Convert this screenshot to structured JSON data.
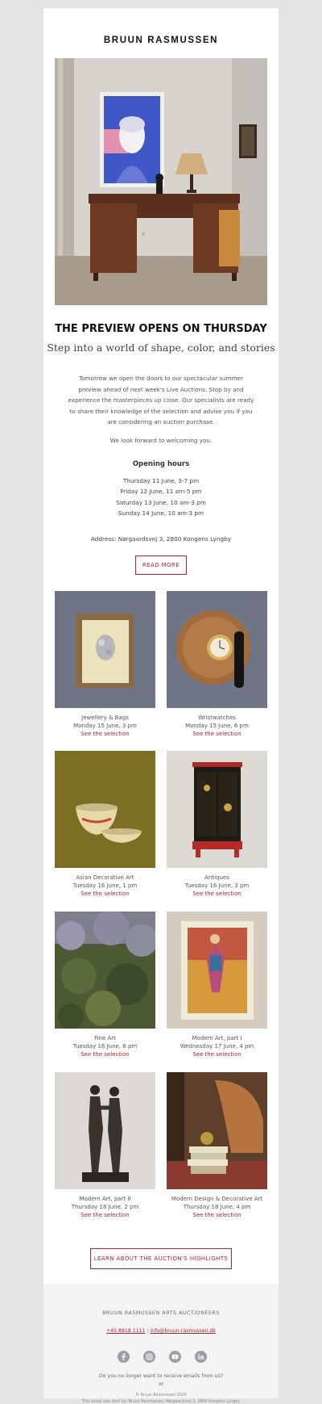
{
  "brand": "BRUUN RASMUSSEN",
  "hero": {
    "title": "THE PREVIEW OPENS ON THURSDAY",
    "subtitle": "Step into a world of shape, color, and stories"
  },
  "intro": {
    "line1": "Tomorrow we open the doors to our spectacular summer",
    "line2": "preview ahead of next week's Live Auctions. Stop by and",
    "line3": "experience the masterpieces up close. Our specialists are ready",
    "line4": "to share their knowledge of the selection and advise you if you",
    "line5": "are considering an auction purchase.",
    "welcome": "We look forward to welcoming you."
  },
  "opening_hours": {
    "heading": "Opening hours",
    "items": [
      "Thursday 11 June, 3-7 pm",
      "Friday 12 June, 11 am-5 pm",
      "Saturday 13 June, 10 am-3 pm",
      "Sunday 14 June, 10 am-3 pm"
    ]
  },
  "address": "Address: Nørgaardsvej 3, 2800 Kongens Lyngby",
  "buttons": {
    "read_more": "READ MORE",
    "learn": "LEARN ABOUT THE AUCTION'S HIGHLIGHTS"
  },
  "auctions": [
    {
      "category": "Jewellery & Bags",
      "date": "Monday 15 June, 3 pm",
      "link": "See the selection"
    },
    {
      "category": "Wristwatches",
      "date": "Monday 15 June, 6 pm",
      "link": "See the selection"
    },
    {
      "category": "Asian Decorative Art",
      "date": "Tuesday 16 June, 1 pm",
      "link": "See the selection"
    },
    {
      "category": "Antiques",
      "date": "Tuesday 16 June, 3 pm",
      "link": "See the selection"
    },
    {
      "category": "Fine Art",
      "date": "Tuesday 16 June, 6 pm",
      "link": "See the selection"
    },
    {
      "category": "Modern Art, part I",
      "date": "Wednesday 17 June, 4 pm",
      "link": "See the selection"
    },
    {
      "category": "Modern Art, part II",
      "date": "Thursday 18 June, 2 pm",
      "link": "See the selection"
    },
    {
      "category": "Modern Design & Decorative Art",
      "date": "Thursday 18 June, 4 pm",
      "link": "See the selection"
    }
  ],
  "footer": {
    "company": "BRUUN RASMUSSEN ARTS AUCTIONEERS",
    "phone": "+45 8818 1111",
    "separator": "|",
    "email": "info@bruun-rasmussen.dk",
    "social_icons": [
      "facebook-icon",
      "instagram-icon",
      "youtube-icon",
      "linkedin-icon"
    ],
    "unsubscribe": "Do you no longer want to receive emails from us?",
    "or": "or",
    "copyright": "© Bruun Rasmussen 2026",
    "sent_by": "This email was sent by: Bruun Rasmussen, Nørgaardsvej 3, 2800 Kongens Lyngby"
  },
  "colors": {
    "accent": "#b72033",
    "background": "#e4e4e4",
    "footer_bg": "#f4f4f4",
    "social_icon": "#9aa0a8"
  }
}
